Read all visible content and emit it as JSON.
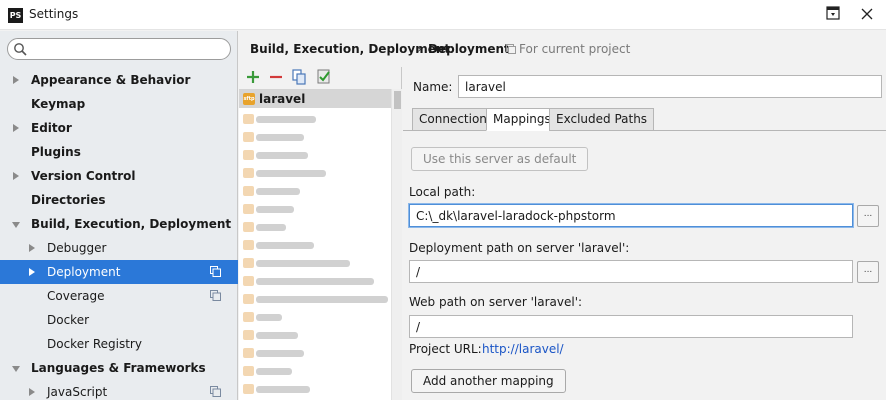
{
  "window": {
    "app_icon": "PS",
    "title": "Settings"
  },
  "search": {
    "placeholder": "",
    "value": ""
  },
  "tree": {
    "items": [
      {
        "label": "Appearance & Behavior",
        "bold": true,
        "arrow": "right",
        "level": 0
      },
      {
        "label": "Keymap",
        "bold": true,
        "arrow": "none",
        "level": 0
      },
      {
        "label": "Editor",
        "bold": true,
        "arrow": "right",
        "level": 0
      },
      {
        "label": "Plugins",
        "bold": true,
        "arrow": "none",
        "level": 0
      },
      {
        "label": "Version Control",
        "bold": true,
        "arrow": "right",
        "level": 0
      },
      {
        "label": "Directories",
        "bold": true,
        "arrow": "none",
        "level": 0
      },
      {
        "label": "Build, Execution, Deployment",
        "bold": true,
        "arrow": "down",
        "level": 0
      },
      {
        "label": "Debugger",
        "bold": false,
        "arrow": "right",
        "level": 1
      },
      {
        "label": "Deployment",
        "bold": false,
        "arrow": "right",
        "level": 1,
        "selected": true,
        "project_icon": true
      },
      {
        "label": "Coverage",
        "bold": false,
        "arrow": "none",
        "level": 1,
        "project_icon": true
      },
      {
        "label": "Docker",
        "bold": false,
        "arrow": "none",
        "level": 1
      },
      {
        "label": "Docker Registry",
        "bold": false,
        "arrow": "none",
        "level": 1
      },
      {
        "label": "Languages & Frameworks",
        "bold": true,
        "arrow": "down",
        "level": 0
      },
      {
        "label": "JavaScript",
        "bold": false,
        "arrow": "right",
        "level": 1,
        "project_icon": true
      }
    ]
  },
  "header": {
    "breadcrumb_parent": "Build, Execution, Deployment",
    "breadcrumb_separator": "›",
    "breadcrumb_current": "Deployment",
    "scope_note": "For current project"
  },
  "servers": {
    "toolbar_icons": [
      "add-icon",
      "remove-icon",
      "copy-icon",
      "check-icon"
    ],
    "selected_server": {
      "icon_text": "sftp",
      "label": "laravel"
    },
    "blurred_rows": 16
  },
  "details": {
    "name_label": "Name:",
    "name_value": "laravel",
    "tabs": [
      "Connection",
      "Mappings",
      "Excluded Paths"
    ],
    "active_tab": "Mappings",
    "use_default_button": "Use this server as default",
    "local_path_label": "Local path:",
    "local_path_value": "C:\\_dk\\laravel-laradock-phpstorm",
    "deployment_path_label": "Deployment path on server 'laravel':",
    "deployment_path_value": "/",
    "web_path_label": "Web path on server 'laravel':",
    "web_path_value": "/",
    "project_url_label": "Project URL:",
    "project_url_value": "http://laravel/",
    "add_mapping_button": "Add another mapping",
    "browse_label": "..."
  },
  "colors": {
    "selection": "#2b78d8",
    "link": "#1a55c6",
    "focus": "#4f8fd8"
  }
}
